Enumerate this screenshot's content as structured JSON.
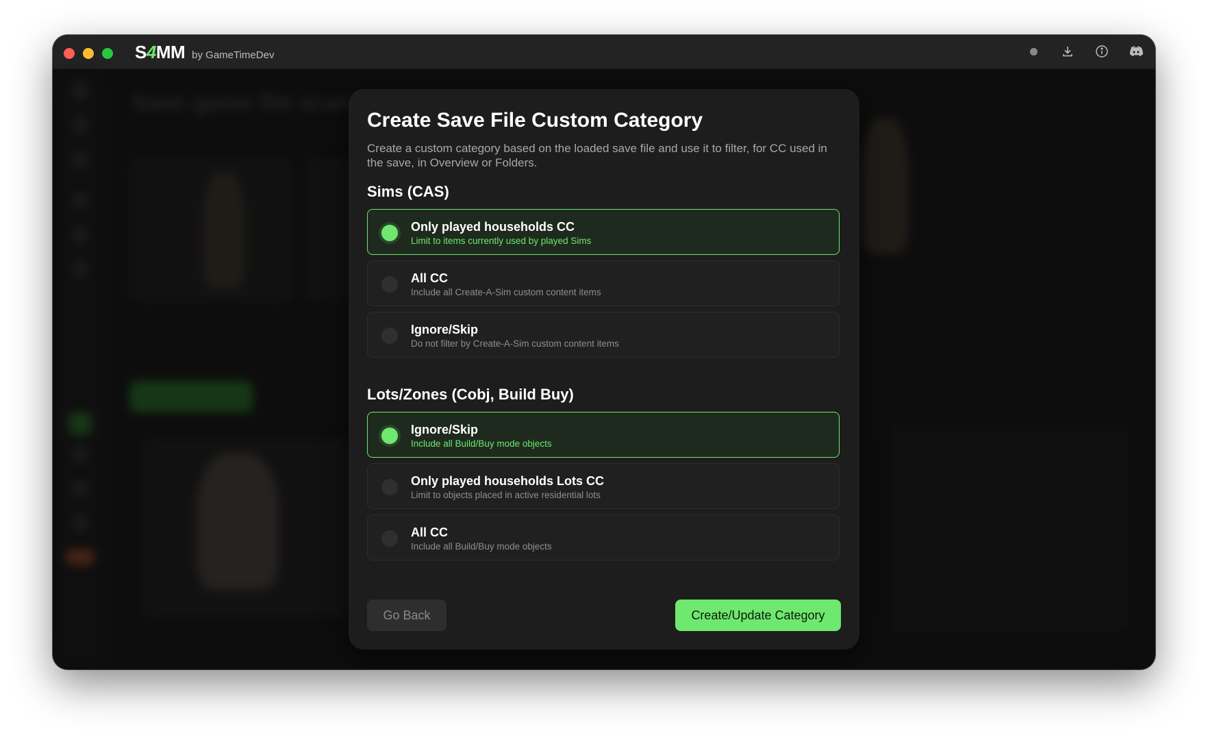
{
  "app": {
    "logo_prefix": "S",
    "logo_four": "4",
    "logo_suffix": "MM",
    "byline": "by GameTimeDev"
  },
  "titlebar_icons": [
    "status-dot",
    "download-icon",
    "info-icon",
    "discord-icon"
  ],
  "background": {
    "title": "Save game file scan"
  },
  "modal": {
    "title": "Create Save File Custom Category",
    "description": "Create a custom category based on the loaded save file and use it to filter, for CC used in the save, in Overview or Folders.",
    "sections": [
      {
        "title": "Sims (CAS)",
        "options": [
          {
            "label": "Only played households CC",
            "sub": "Limit to items currently used by played Sims",
            "selected": true
          },
          {
            "label": "All CC",
            "sub": "Include all Create-A-Sim custom content items",
            "selected": false
          },
          {
            "label": "Ignore/Skip",
            "sub": "Do not filter by Create-A-Sim custom content items",
            "selected": false
          }
        ]
      },
      {
        "title": "Lots/Zones (Cobj, Build Buy)",
        "options": [
          {
            "label": "Ignore/Skip",
            "sub": "Include all Build/Buy mode objects",
            "selected": true
          },
          {
            "label": "Only played households Lots CC",
            "sub": "Limit to objects placed in active residential lots",
            "selected": false
          },
          {
            "label": "All CC",
            "sub": "Include all Build/Buy mode objects",
            "selected": false
          }
        ]
      }
    ],
    "back_label": "Go Back",
    "create_label": "Create/Update Category"
  },
  "colors": {
    "accent": "#6ee86e",
    "modal_bg": "#1d1d1d",
    "window_bg": "#141414"
  }
}
